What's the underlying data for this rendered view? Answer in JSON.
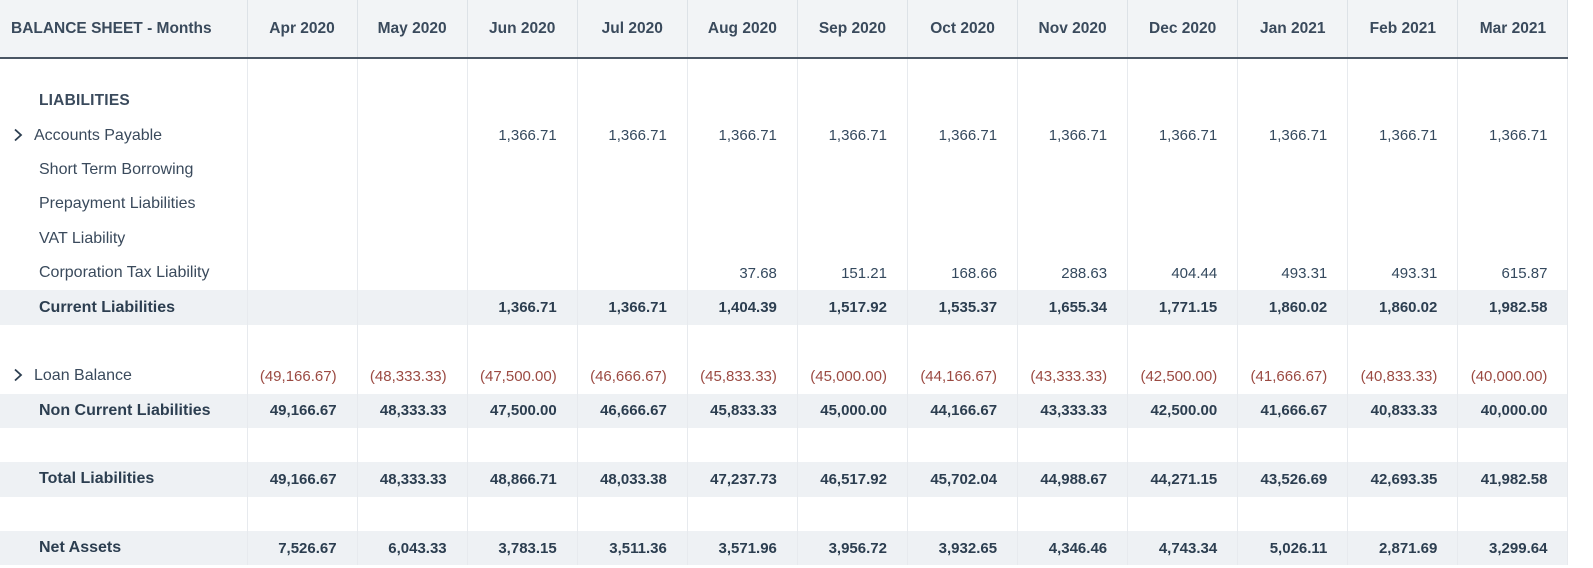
{
  "header": {
    "title": "BALANCE SHEET - Months",
    "months": [
      "Apr 2020",
      "May 2020",
      "Jun 2020",
      "Jul 2020",
      "Aug 2020",
      "Sep 2020",
      "Oct 2020",
      "Nov 2020",
      "Dec 2020",
      "Jan 2021",
      "Feb 2021",
      "Mar 2021"
    ]
  },
  "section": {
    "label": "LIABILITIES"
  },
  "rows": {
    "accounts_payable": {
      "label": "Accounts Payable",
      "values": [
        "",
        "",
        "1,366.71",
        "1,366.71",
        "1,366.71",
        "1,366.71",
        "1,366.71",
        "1,366.71",
        "1,366.71",
        "1,366.71",
        "1,366.71",
        "1,366.71"
      ]
    },
    "short_term_borrowing": {
      "label": "Short Term Borrowing",
      "values": [
        "",
        "",
        "",
        "",
        "",
        "",
        "",
        "",
        "",
        "",
        "",
        ""
      ]
    },
    "prepayment_liabilities": {
      "label": "Prepayment Liabilities",
      "values": [
        "",
        "",
        "",
        "",
        "",
        "",
        "",
        "",
        "",
        "",
        "",
        ""
      ]
    },
    "vat_liability": {
      "label": "VAT Liability",
      "values": [
        "",
        "",
        "",
        "",
        "",
        "",
        "",
        "",
        "",
        "",
        "",
        ""
      ]
    },
    "corporation_tax": {
      "label": "Corporation Tax Liability",
      "values": [
        "",
        "",
        "",
        "",
        "37.68",
        "151.21",
        "168.66",
        "288.63",
        "404.44",
        "493.31",
        "493.31",
        "615.87"
      ]
    },
    "current_liabilities": {
      "label": "Current Liabilities",
      "values": [
        "",
        "",
        "1,366.71",
        "1,366.71",
        "1,404.39",
        "1,517.92",
        "1,535.37",
        "1,655.34",
        "1,771.15",
        "1,860.02",
        "1,860.02",
        "1,982.58"
      ]
    },
    "loan_balance": {
      "label": "Loan Balance",
      "values": [
        "(49,166.67)",
        "(48,333.33)",
        "(47,500.00)",
        "(46,666.67)",
        "(45,833.33)",
        "(45,000.00)",
        "(44,166.67)",
        "(43,333.33)",
        "(42,500.00)",
        "(41,666.67)",
        "(40,833.33)",
        "(40,000.00)"
      ]
    },
    "non_current_liabilities": {
      "label": "Non Current Liabilities",
      "values": [
        "49,166.67",
        "48,333.33",
        "47,500.00",
        "46,666.67",
        "45,833.33",
        "45,000.00",
        "44,166.67",
        "43,333.33",
        "42,500.00",
        "41,666.67",
        "40,833.33",
        "40,000.00"
      ]
    },
    "total_liabilities": {
      "label": "Total Liabilities",
      "values": [
        "49,166.67",
        "48,333.33",
        "48,866.71",
        "48,033.38",
        "47,237.73",
        "46,517.92",
        "45,702.04",
        "44,988.67",
        "44,271.15",
        "43,526.69",
        "42,693.35",
        "41,982.58"
      ]
    },
    "net_assets": {
      "label": "Net Assets",
      "values": [
        "7,526.67",
        "6,043.33",
        "3,783.15",
        "3,511.36",
        "3,571.96",
        "3,956.72",
        "3,932.65",
        "4,346.46",
        "4,743.34",
        "5,026.11",
        "2,871.69",
        "3,299.64"
      ]
    }
  },
  "colors": {
    "header_bg": "#f2f4f6",
    "total_bg": "#eef1f4",
    "negative": "#9b4a42",
    "text": "#34495e"
  }
}
